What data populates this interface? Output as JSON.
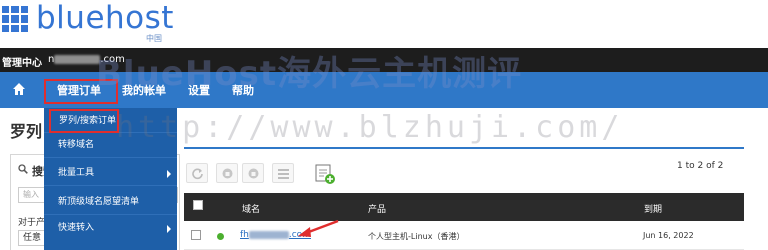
{
  "logo": {
    "text": "bluehost",
    "subtext": "中国"
  },
  "account": {
    "label": "管理中心",
    "email_prefix": "n",
    "email_suffix": ".com"
  },
  "nav": {
    "items": [
      {
        "label": "管理订单"
      },
      {
        "label": "我的帐单"
      },
      {
        "label": "设置"
      },
      {
        "label": "帮助"
      }
    ]
  },
  "dropdown": {
    "items": [
      {
        "label": "罗列/搜索订单"
      },
      {
        "label": "转移域名"
      },
      {
        "label": "批量工具"
      },
      {
        "label": "新顶级域名愿望清单"
      },
      {
        "label": "快速转入"
      }
    ]
  },
  "watermark": {
    "line1": "BlueHost海外云主机测评",
    "line2": "http://www.blzhuji.com/"
  },
  "content": {
    "title": "罗列",
    "search_label": "搜索",
    "input_placeholder": "输入",
    "side_label": "对于产",
    "side_select": "任意"
  },
  "pager": {
    "text": "1 to 2 of 2"
  },
  "table": {
    "headers": [
      "域名",
      "产品",
      "到期"
    ],
    "rows": [
      {
        "domain_prefix": "fh",
        "domain_suffix": ".com",
        "product": "个人型主机-Linux（香港）",
        "expiry": "Jun 16, 2022",
        "status_color": "#4caf2f"
      }
    ]
  },
  "colors": {
    "brand": "#3575d3",
    "nav": "#2f78c8",
    "highlight": "#e02e2e"
  }
}
